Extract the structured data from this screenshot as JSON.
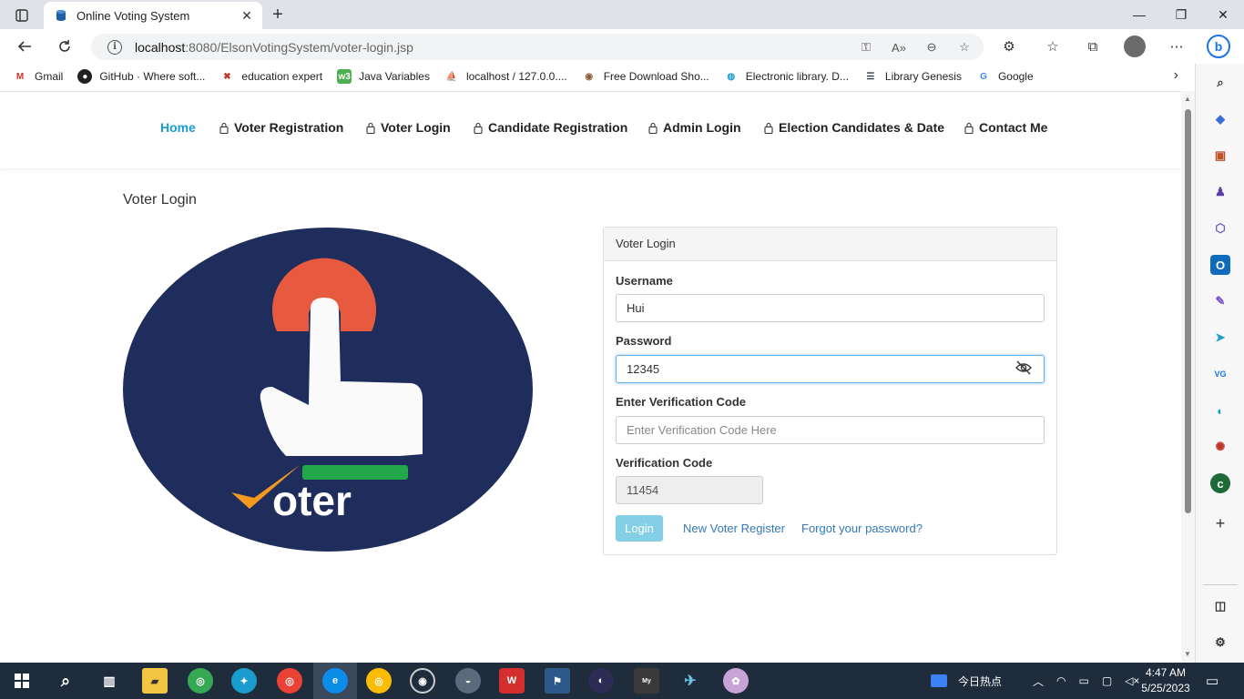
{
  "browser": {
    "tab_title": "Online Voting System",
    "url_host": "localhost",
    "url_rest": ":8080/ElsonVotingSystem/voter-login.jsp",
    "favorites": [
      {
        "label": "Gmail",
        "icon": "gmail-icon"
      },
      {
        "label": "GitHub · Where soft...",
        "icon": "github-icon"
      },
      {
        "label": "education expert",
        "icon": "education-icon"
      },
      {
        "label": "Java Variables",
        "icon": "w3-icon"
      },
      {
        "label": "localhost / 127.0.0....",
        "icon": "phpmyadmin-icon"
      },
      {
        "label": "Free Download Sho...",
        "icon": "download-icon"
      },
      {
        "label": "Electronic library. D...",
        "icon": "library-icon"
      },
      {
        "label": "Library Genesis",
        "icon": "libgen-icon"
      },
      {
        "label": "Google",
        "icon": "google-icon"
      }
    ]
  },
  "nav": {
    "items": [
      {
        "label": "Home"
      },
      {
        "label": "Voter Registration"
      },
      {
        "label": "Voter Login"
      },
      {
        "label": "Candidate Registration"
      },
      {
        "label": "Admin Login"
      },
      {
        "label": "Election Candidates & Date"
      },
      {
        "label": "Contact Me"
      }
    ]
  },
  "page": {
    "heading": "Voter Login",
    "logo_text": "oter"
  },
  "login_panel": {
    "title": "Voter Login",
    "username_label": "Username",
    "username_value": "Hui",
    "password_label": "Password",
    "password_value": "12345",
    "verify_label": "Enter Verification Code",
    "verify_placeholder": "Enter Verification Code Here",
    "code_label": "Verification Code",
    "code_value": "11454",
    "login_button": "Login",
    "register_link": "New Voter Register",
    "forgot_link": "Forgot your password?"
  },
  "taskbar": {
    "news_label": "今日热点",
    "time": "4:47 AM",
    "date": "5/25/2023"
  },
  "colors": {
    "accent": "#1a9ccf",
    "logo_navy": "#1f2d5c",
    "logo_red": "#e85a3f",
    "logo_green": "#22a84a",
    "logo_orange": "#f39a1e",
    "button": "#5bc0de",
    "link": "#337ab7"
  }
}
